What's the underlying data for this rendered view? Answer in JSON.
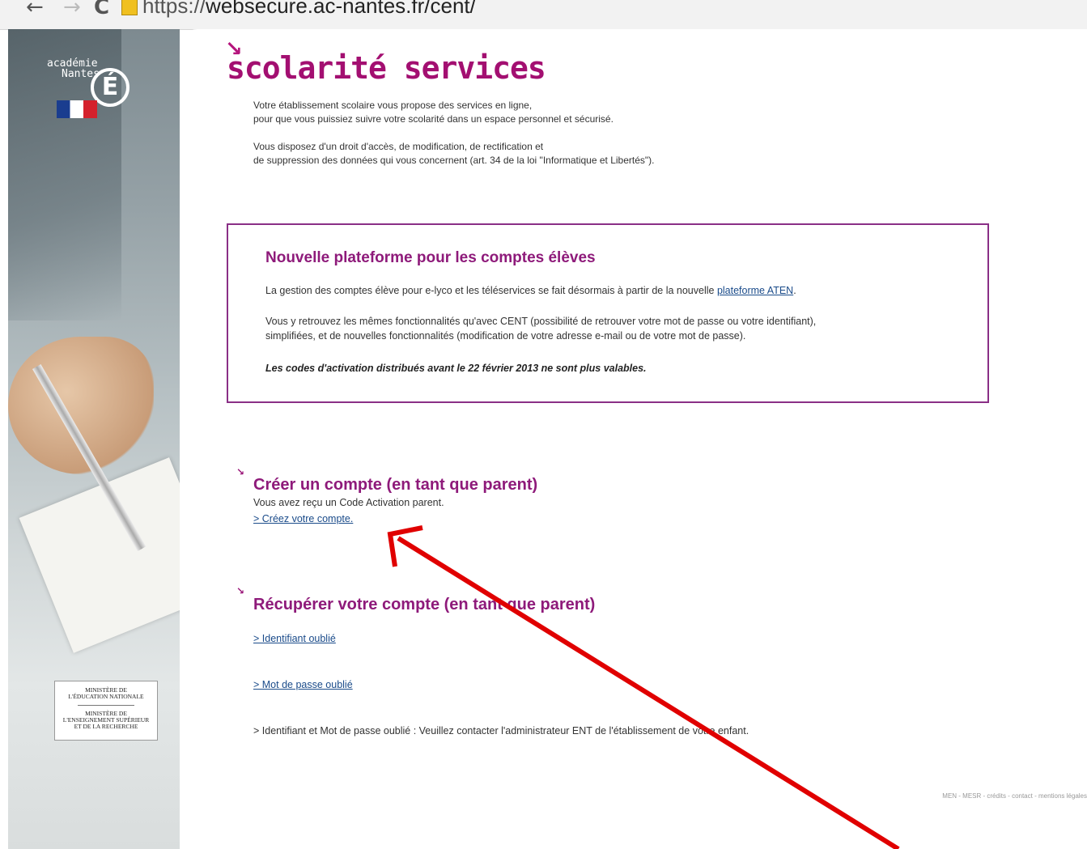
{
  "browser": {
    "back": "←",
    "forward": "→",
    "reload": "C",
    "url_prefix": "https://",
    "url_host": "websecure.ac-nantes.fr/cent/"
  },
  "sidebar": {
    "logo_line1": "académie",
    "logo_line2": "Nantes",
    "logo_letter": "É",
    "ministry_1a": "MINISTÈRE DE",
    "ministry_1b": "L'ÉDUCATION NATIONALE",
    "ministry_2a": "MINISTÈRE DE",
    "ministry_2b": "L'ENSEIGNEMENT SUPÉRIEUR",
    "ministry_2c": "ET DE LA RECHERCHE"
  },
  "header": {
    "brand": "scolarité services"
  },
  "intro": {
    "line1": "Votre établissement scolaire vous propose des services en ligne,",
    "line2": "pour que vous puissiez suivre votre scolarité dans un espace personnel et sécurisé.",
    "line3": "Vous disposez d'un droit d'accès, de modification, de rectification et",
    "line4": "de suppression des données qui vous concernent (art. 34 de la loi \"Informatique et Libertés\")."
  },
  "notice": {
    "title": "Nouvelle plateforme pour les comptes élèves",
    "p1_text": "La gestion des comptes élève pour e-lyco et les téléservices se fait désormais à partir de la nouvelle ",
    "p1_link": "plateforme ATEN",
    "p1_end": ".",
    "p2_line1": "Vous y retrouvez les mêmes fonctionnalités qu'avec CENT (possibilité de retrouver votre mot de passe ou votre identifiant),",
    "p2_line2": "simplifiées, et de nouvelles fonctionnalités (modification de votre adresse e-mail ou de votre mot de passe).",
    "p3": "Les codes d'activation distribués avant le 22 février 2013 ne sont plus valables."
  },
  "create": {
    "icon": "↘",
    "title": "Créer un compte (en tant que parent)",
    "subtitle": "Vous avez reçu un Code Activation parent.",
    "link": "> Créez votre compte."
  },
  "recover": {
    "icon": "↘",
    "title": "Récupérer votre compte (en tant que parent)",
    "link_id": "> Identifiant oublié",
    "link_pwd": "> Mot de passe oublié",
    "both": "> Identifiant et Mot de passe oublié : Veuillez contacter l'administrateur ENT de l'établissement de votre enfant."
  },
  "footer": {
    "text": "MEN - MESR - crédits - contact - mentions légales"
  },
  "colors": {
    "brand": "#a30f71",
    "title": "#8e1a7a",
    "annotation_arrow": "#e00000"
  }
}
